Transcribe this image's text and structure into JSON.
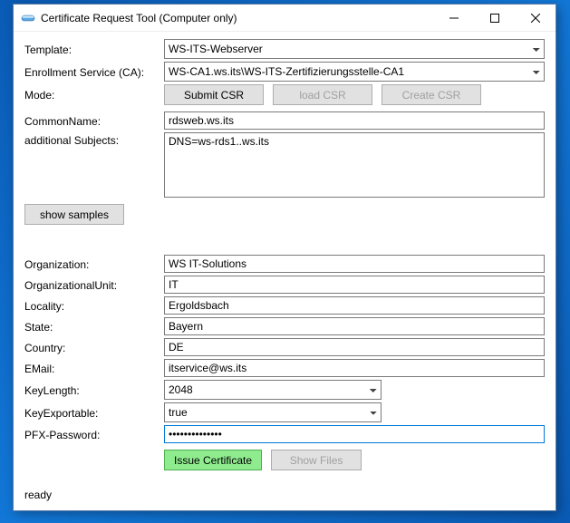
{
  "window": {
    "title": "Certificate Request Tool (Computer only)"
  },
  "labels": {
    "template": "Template:",
    "enrollment": "Enrollment Service (CA):",
    "mode": "Mode:",
    "commonName": "CommonName:",
    "additional": "additional Subjects:",
    "org": "Organization:",
    "ou": "OrganizationalUnit:",
    "locality": "Locality:",
    "state": "State:",
    "country": "Country:",
    "email": "EMail:",
    "keyLength": "KeyLength:",
    "keyExportable": "KeyExportable:",
    "pfx": "PFX-Password:"
  },
  "buttons": {
    "submit": "Submit CSR",
    "load": "load CSR",
    "create": "Create CSR",
    "samples": "show samples",
    "issue": "Issue Certificate",
    "showFiles": "Show Files"
  },
  "values": {
    "template": "WS-ITS-Webserver",
    "enrollment": "WS-CA1.ws.its\\WS-ITS-Zertifizierungsstelle-CA1",
    "commonName": "rdsweb.ws.its",
    "additional": "DNS=ws-rds1..ws.its",
    "org": "WS IT-Solutions",
    "ou": "IT",
    "locality": "Ergoldsbach",
    "state": "Bayern",
    "country": "DE",
    "email": "itservice@ws.its",
    "keyLength": "2048",
    "keyExportable": "true",
    "pfxMasked": "••••••••••••••"
  },
  "status": "ready"
}
